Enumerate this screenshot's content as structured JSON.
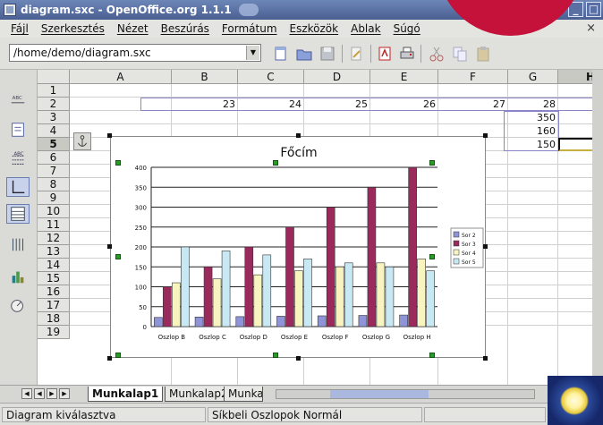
{
  "window": {
    "title": "diagram.sxc - OpenOffice.org 1.1.1"
  },
  "menu": [
    "Fájl",
    "Szerkesztés",
    "Nézet",
    "Beszúrás",
    "Formátum",
    "Eszközök",
    "Ablak",
    "Súgó"
  ],
  "menu_close": "×",
  "toolbar": {
    "url": "/home/demo/diagram.sxc"
  },
  "columns": [
    "A",
    "B",
    "C",
    "D",
    "E",
    "F",
    "G",
    "H"
  ],
  "rows": [
    "1",
    "2",
    "3",
    "4",
    "5",
    "6",
    "7",
    "8",
    "9",
    "10",
    "11",
    "12",
    "13",
    "14",
    "15",
    "16",
    "17",
    "18",
    "19"
  ],
  "cells": {
    "b2": "23",
    "c2": "24",
    "d2": "25",
    "e2": "26",
    "f2": "27",
    "g2": "28",
    "g3": "350",
    "g4": "160",
    "g5": "150"
  },
  "sheets": [
    "Munkalap1",
    "Munkalap2",
    "Munka"
  ],
  "status": {
    "left": "Diagram kiválasztva",
    "middle": "Síkbeli Oszlopok Normál"
  },
  "chart_data": {
    "type": "bar",
    "title": "Főcím",
    "categories": [
      "Oszlop B",
      "Oszlop C",
      "Oszlop D",
      "Oszlop E",
      "Oszlop F",
      "Oszlop G",
      "Oszlop H"
    ],
    "series": [
      {
        "name": "Sor 2",
        "values": [
          23,
          24,
          25,
          26,
          27,
          28,
          29
        ],
        "color": "#8f93d8"
      },
      {
        "name": "Sor 3",
        "values": [
          100,
          150,
          200,
          250,
          300,
          350,
          400
        ],
        "color": "#9a2a5c"
      },
      {
        "name": "Sor 4",
        "values": [
          110,
          120,
          130,
          140,
          150,
          160,
          170
        ],
        "color": "#f8f4c0"
      },
      {
        "name": "Sor 5",
        "values": [
          200,
          190,
          180,
          170,
          160,
          150,
          140
        ],
        "color": "#c8e8f4"
      }
    ],
    "yticks": [
      "0",
      "50",
      "100",
      "150",
      "200",
      "250",
      "300",
      "350",
      "400"
    ],
    "ylim": [
      0,
      400
    ],
    "grid": true,
    "legend": "right"
  }
}
